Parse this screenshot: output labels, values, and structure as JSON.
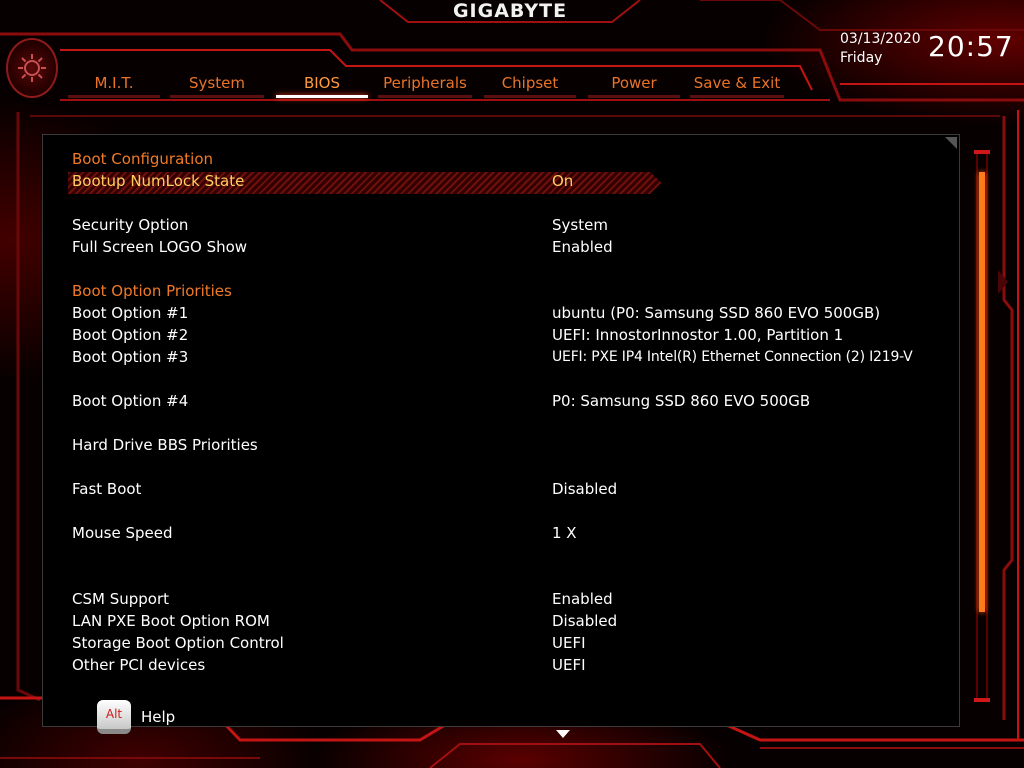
{
  "header": {
    "brand": "GIGABYTE",
    "date": "03/13/2020",
    "day": "Friday",
    "time": "20:57"
  },
  "tabs": [
    {
      "label": "M.I.T.",
      "active": false
    },
    {
      "label": "System",
      "active": false
    },
    {
      "label": "BIOS",
      "active": true
    },
    {
      "label": "Peripherals",
      "active": false
    },
    {
      "label": "Chipset",
      "active": false
    },
    {
      "label": "Power",
      "active": false
    },
    {
      "label": "Save & Exit",
      "active": false
    }
  ],
  "settings": {
    "boot_configuration_heading": "Boot Configuration",
    "bootup_numlock": {
      "label": "Bootup NumLock State",
      "value": "On"
    },
    "security_option": {
      "label": "Security Option",
      "value": "System"
    },
    "full_screen_logo": {
      "label": "Full Screen LOGO Show",
      "value": "Enabled"
    },
    "boot_priorities_heading": "Boot Option Priorities",
    "boot_option_1": {
      "label": "Boot Option #1",
      "value": "ubuntu (P0: Samsung SSD 860 EVO 500GB)"
    },
    "boot_option_2": {
      "label": "Boot Option #2",
      "value": "UEFI: InnostorInnostor 1.00, Partition 1"
    },
    "boot_option_3": {
      "label": "Boot Option #3",
      "value": "UEFI: PXE IP4 Intel(R) Ethernet Connection (2) I219-V"
    },
    "boot_option_4": {
      "label": "Boot Option #4",
      "value": "P0: Samsung SSD 860 EVO 500GB"
    },
    "hdd_bbs": {
      "label": "Hard Drive BBS Priorities"
    },
    "fast_boot": {
      "label": "Fast Boot",
      "value": "Disabled"
    },
    "mouse_speed": {
      "label": "Mouse Speed",
      "value": "1 X"
    },
    "csm_support": {
      "label": "CSM Support",
      "value": "Enabled"
    },
    "lan_pxe": {
      "label": "LAN PXE Boot Option ROM",
      "value": "Disabled"
    },
    "storage_boot": {
      "label": "Storage Boot Option Control",
      "value": "UEFI"
    },
    "other_pci": {
      "label": "Other PCI devices",
      "value": "UEFI"
    }
  },
  "footer": {
    "alt_key": "Alt",
    "help_label": "Help"
  },
  "colors": {
    "accent_orange": "#f07a28",
    "selected_text": "#ffd060",
    "frame_red": "#c41414"
  },
  "icons": {
    "gear": "gear-icon",
    "scroll_down": "triangle-down-icon",
    "side_arrow": "chevron-right-icon"
  }
}
